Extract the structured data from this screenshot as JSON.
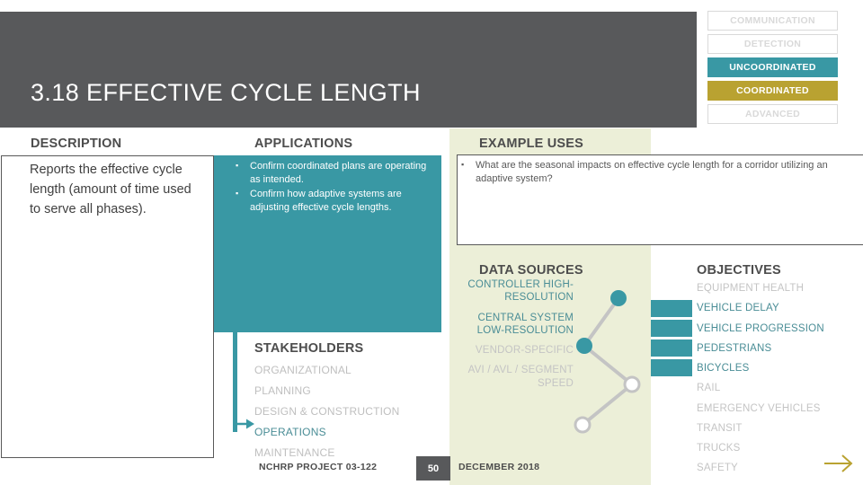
{
  "header": {
    "title": "3.18 EFFECTIVE CYCLE LENGTH",
    "bar_color": "#58595b"
  },
  "capability_badges": {
    "items": [
      {
        "label": "COMMUNICATION",
        "state": "inactive"
      },
      {
        "label": "DETECTION",
        "state": "inactive"
      },
      {
        "label": "UNCOORDINATED",
        "state": "teal"
      },
      {
        "label": "COORDINATED",
        "state": "gold"
      },
      {
        "label": "ADVANCED",
        "state": "inactive"
      }
    ],
    "teal_color": "#3998a4",
    "gold_color": "#b9a231",
    "inactive_color": "#d9d9d9"
  },
  "description": {
    "heading": "DESCRIPTION",
    "text": "Reports the effective cycle length (amount of time used to serve all phases)."
  },
  "applications": {
    "heading": "APPLICATIONS",
    "panel_color": "#3998a4",
    "bullets": [
      "Confirm coordinated plans are operating as intended.",
      "Confirm how adaptive systems are adjusting effective cycle lengths."
    ]
  },
  "example_uses": {
    "heading": "EXAMPLE USES",
    "panel_color": "#ecefd8",
    "bullets": [
      "What are the seasonal impacts on effective cycle length for a corridor utilizing an adaptive system?"
    ]
  },
  "stakeholders": {
    "heading": "STAKEHOLDERS",
    "items": [
      {
        "label": "ORGANIZATIONAL",
        "active": false
      },
      {
        "label": "PLANNING",
        "active": false
      },
      {
        "label": "DESIGN & CONSTRUCTION",
        "active": false
      },
      {
        "label": "OPERATIONS",
        "active": true
      },
      {
        "label": "MAINTENANCE",
        "active": false
      }
    ],
    "active_color": "#4a8d96",
    "inactive_color": "#bfbfbf"
  },
  "data_sources": {
    "heading": "DATA SOURCES",
    "items": [
      {
        "label": "CONTROLLER HIGH-RESOLUTION",
        "active": true
      },
      {
        "label": "CENTRAL SYSTEM LOW-RESOLUTION",
        "active": true
      },
      {
        "label": "VENDOR-SPECIFIC",
        "active": false
      },
      {
        "label": "AVI / AVL / SEGMENT SPEED",
        "active": false
      }
    ],
    "node_active_color": "#3998a4",
    "node_inactive_color": "#ffffff",
    "connector_color": "#c4c4c4"
  },
  "objectives": {
    "heading": "OBJECTIVES",
    "items": [
      {
        "label": "EQUIPMENT HEALTH",
        "active": false
      },
      {
        "label": "VEHICLE DELAY",
        "active": true
      },
      {
        "label": "VEHICLE PROGRESSION",
        "active": true
      },
      {
        "label": "PEDESTRIANS",
        "active": true
      },
      {
        "label": "BICYCLES",
        "active": true
      },
      {
        "label": "RAIL",
        "active": false
      },
      {
        "label": "EMERGENCY VEHICLES",
        "active": false
      },
      {
        "label": "TRANSIT",
        "active": false
      },
      {
        "label": "TRUCKS",
        "active": false
      },
      {
        "label": "SAFETY",
        "active": false
      }
    ],
    "bar_count": 4,
    "bar_color": "#3998a4",
    "active_color": "#4a8d96",
    "inactive_color": "#c4c4c4"
  },
  "footer": {
    "project": "NCHRP PROJECT 03-122",
    "page": "50",
    "date": "DECEMBER 2018",
    "next_arrow_color": "#b9a231"
  }
}
